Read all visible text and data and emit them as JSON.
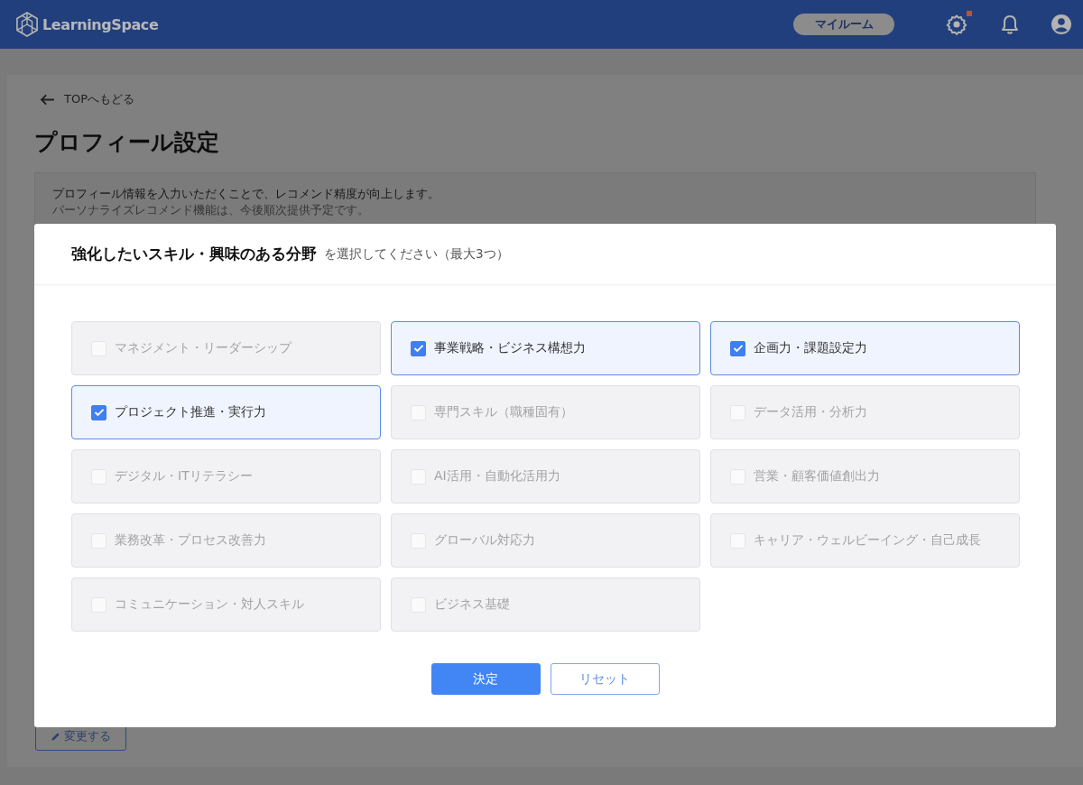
{
  "header": {
    "logo_text": "LearningSpace",
    "my_room_button": "マイルーム",
    "settings_badge": true
  },
  "page": {
    "back_link": "TOPへもどる",
    "title": "プロフィール設定",
    "notice": [
      "プロフィール情報を入力いただくことで、レコメンド精度が向上します。",
      "パーソナライズレコメンド機能は、今後順次提供予定です。"
    ],
    "edit_button": "変更する"
  },
  "modal": {
    "title": "強化したいスキル・興味のある分野",
    "subtitle": "を選択してください（最大3つ）",
    "options": [
      {
        "label": "マネジメント・リーダーシップ",
        "checked": false,
        "disabled": true
      },
      {
        "label": "事業戦略・ビジネス構想力",
        "checked": true,
        "disabled": false
      },
      {
        "label": "企画力・課題設定力",
        "checked": true,
        "disabled": false
      },
      {
        "label": "プロジェクト推進・実行力",
        "checked": true,
        "disabled": false
      },
      {
        "label": "専門スキル（職種固有）",
        "checked": false,
        "disabled": true
      },
      {
        "label": "データ活用・分析力",
        "checked": false,
        "disabled": true
      },
      {
        "label": "デジタル・ITリテラシー",
        "checked": false,
        "disabled": true
      },
      {
        "label": "AI活用・自動化活用力",
        "checked": false,
        "disabled": true
      },
      {
        "label": "営業・顧客価値創出力",
        "checked": false,
        "disabled": true
      },
      {
        "label": "業務改革・プロセス改善力",
        "checked": false,
        "disabled": true
      },
      {
        "label": "グローバル対応力",
        "checked": false,
        "disabled": true
      },
      {
        "label": "キャリア・ウェルビーイング・自己成長",
        "checked": false,
        "disabled": true
      },
      {
        "label": "コミュニケーション・対人スキル",
        "checked": false,
        "disabled": true
      },
      {
        "label": "ビジネス基礎",
        "checked": false,
        "disabled": true
      }
    ],
    "buttons": [
      {
        "label": "決定",
        "kind": "primary"
      },
      {
        "label": "リセット",
        "kind": "secondary"
      }
    ]
  }
}
